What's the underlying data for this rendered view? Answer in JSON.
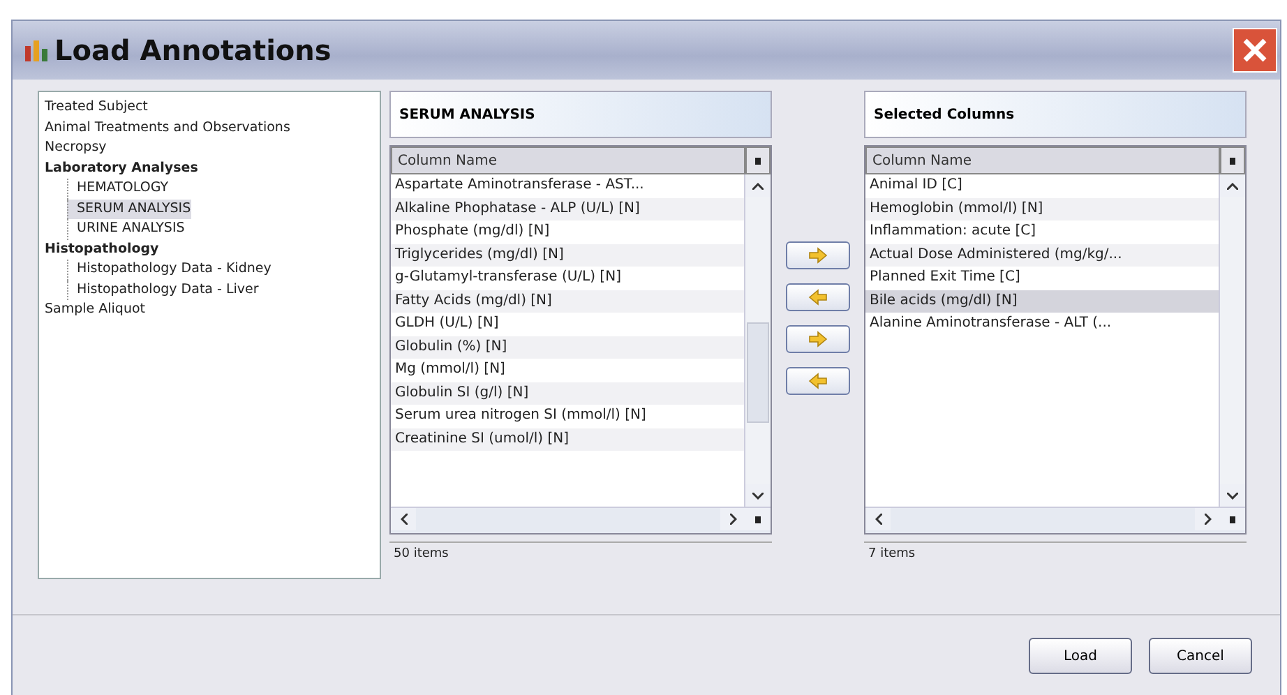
{
  "window": {
    "title": "Load Annotations"
  },
  "tree": [
    {
      "label": "Treated Subject",
      "bold": false,
      "selected": false
    },
    {
      "label": "Animal Treatments and Observations",
      "bold": false,
      "selected": false
    },
    {
      "label": "Necropsy",
      "bold": false,
      "selected": false
    },
    {
      "label": "Laboratory Analyses",
      "bold": true,
      "selected": false,
      "children": [
        {
          "label": "HEMATOLOGY",
          "selected": false
        },
        {
          "label": "SERUM ANALYSIS",
          "selected": true
        },
        {
          "label": "URINE ANALYSIS",
          "selected": false
        }
      ]
    },
    {
      "label": "Histopathology",
      "bold": true,
      "selected": false,
      "children": [
        {
          "label": "Histopathology Data - Kidney",
          "selected": false
        },
        {
          "label": "Histopathology Data - Liver",
          "selected": false
        }
      ]
    },
    {
      "label": "Sample Aliquot",
      "bold": false,
      "selected": false
    }
  ],
  "available": {
    "title": "SERUM ANALYSIS",
    "column": "Column Name",
    "count": "50 items",
    "rows": [
      {
        "text": "Aspartate Aminotransferase - AST...",
        "selected": false
      },
      {
        "text": "Alkaline Phophatase - ALP (U/L) [N]",
        "selected": false
      },
      {
        "text": "Phosphate (mg/dl) [N]",
        "selected": false
      },
      {
        "text": "Triglycerides (mg/dl) [N]",
        "selected": false
      },
      {
        "text": "g-Glutamyl-transferase (U/L) [N]",
        "selected": false
      },
      {
        "text": "Fatty Acids (mg/dl) [N]",
        "selected": false
      },
      {
        "text": "GLDH (U/L) [N]",
        "selected": false
      },
      {
        "text": "Globulin (%) [N]",
        "selected": false
      },
      {
        "text": "Mg (mmol/l) [N]",
        "selected": false
      },
      {
        "text": "Globulin SI (g/l) [N]",
        "selected": false
      },
      {
        "text": "Serum urea nitrogen SI (mmol/l) [N]",
        "selected": false
      },
      {
        "text": "Creatinine SI (umol/l) [N]",
        "selected": false
      }
    ]
  },
  "selected": {
    "title": "Selected Columns",
    "column": "Column Name",
    "count": "7 items",
    "rows": [
      {
        "text": "Animal ID [C]",
        "selected": false
      },
      {
        "text": "Hemoglobin (mmol/l) [N]",
        "selected": false
      },
      {
        "text": "Inflammation: acute [C]",
        "selected": false
      },
      {
        "text": "Actual Dose Administered (mg/kg/...",
        "selected": false
      },
      {
        "text": "Planned Exit Time [C]",
        "selected": false
      },
      {
        "text": "Bile acids (mg/dl) [N]",
        "selected": true
      },
      {
        "text": "Alanine Aminotransferase - ALT (...",
        "selected": false
      }
    ]
  },
  "move_buttons": [
    {
      "kind": "right"
    },
    {
      "kind": "left"
    },
    {
      "kind": "right"
    },
    {
      "kind": "left"
    }
  ],
  "buttons": [
    "Load",
    "Cancel"
  ]
}
